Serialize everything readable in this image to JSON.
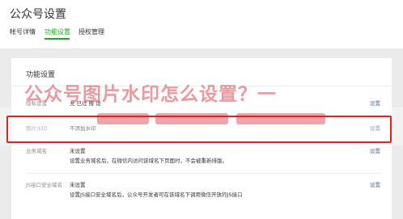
{
  "header": {
    "title": "公众号设置",
    "tabs": [
      {
        "label": "帐号详情",
        "active": false
      },
      {
        "label": "功能设置",
        "active": true
      },
      {
        "label": "授权管理",
        "active": false
      }
    ],
    "accent_color": "#1aad19"
  },
  "panel": {
    "title": "功能设置",
    "rows": [
      {
        "label": "隐私设置",
        "value": "允   已过   搜  设 ",
        "detail": "",
        "action": "设置"
      },
      {
        "label": "图片水印",
        "value": "不添加水印",
        "detail": "",
        "action": "设置"
      },
      {
        "label": "业务域名",
        "value": "未设置",
        "detail": "设置业务域名后，在微信内访问该域名下页面时，不会被重新排版。",
        "action": "设置"
      },
      {
        "label": "JS接口安全域名",
        "value": "未设置",
        "detail": "设置JS接口安全域名后，公众号开发者可在该域名下调用微信开放的JS接口",
        "action": "设置"
      }
    ]
  },
  "overlay": {
    "title": "公众号图片水印怎么设置？一",
    "highlight_color": "#e02222"
  }
}
